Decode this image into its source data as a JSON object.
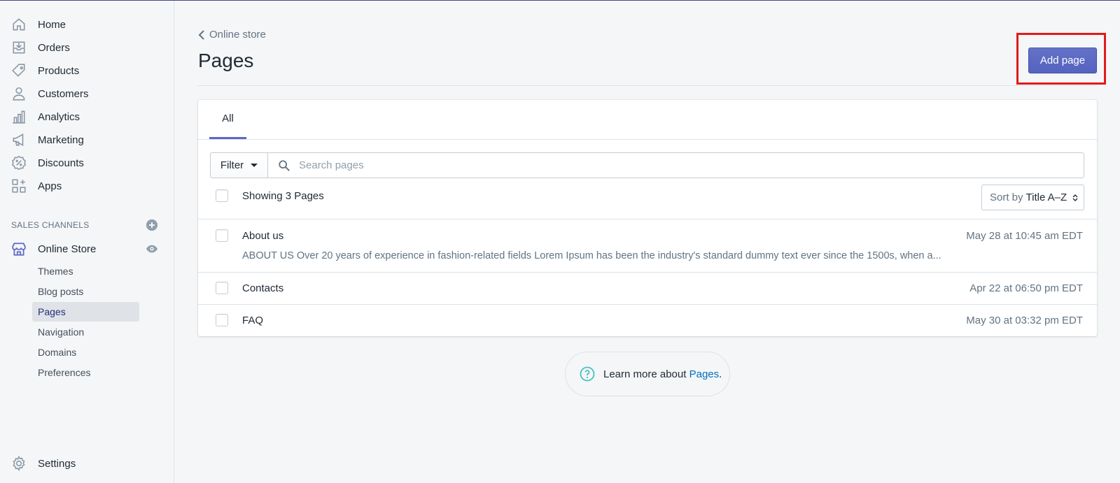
{
  "sidebar": {
    "items": [
      {
        "label": "Home",
        "icon": "home-icon"
      },
      {
        "label": "Orders",
        "icon": "orders-icon"
      },
      {
        "label": "Products",
        "icon": "tag-icon"
      },
      {
        "label": "Customers",
        "icon": "person-icon"
      },
      {
        "label": "Analytics",
        "icon": "bar-chart-icon"
      },
      {
        "label": "Marketing",
        "icon": "megaphone-icon"
      },
      {
        "label": "Discounts",
        "icon": "discount-icon"
      },
      {
        "label": "Apps",
        "icon": "apps-icon"
      }
    ],
    "sales_channels_label": "SALES CHANNELS",
    "online_store": {
      "label": "Online Store",
      "sub_items": [
        "Themes",
        "Blog posts",
        "Pages",
        "Navigation",
        "Domains",
        "Preferences"
      ],
      "active": "Pages"
    },
    "settings_label": "Settings"
  },
  "header": {
    "breadcrumb": "Online store",
    "title": "Pages",
    "add_button": "Add page"
  },
  "card": {
    "tab_all": "All",
    "filter_label": "Filter",
    "search_placeholder": "Search pages",
    "showing": "Showing 3 Pages",
    "sort_prefix": "Sort by",
    "sort_value": "Title A–Z",
    "rows": [
      {
        "title": "About us",
        "date": "May 28 at 10:45 am EDT",
        "excerpt": "ABOUT US Over 20 years of experience in fashion-related fields Lorem Ipsum has been the industry's standard dummy text ever since the 1500s, when a..."
      },
      {
        "title": "Contacts",
        "date": "Apr 22 at 06:50 pm EDT"
      },
      {
        "title": "FAQ",
        "date": "May 30 at 03:32 pm EDT"
      }
    ]
  },
  "learn_more": {
    "text": "Learn more about",
    "link": "Pages",
    "suffix": "."
  },
  "colors": {
    "primary": "#5c6ac4",
    "highlight": "#e11b1b",
    "link": "#006fbb",
    "help_icon": "#47c1bf"
  }
}
